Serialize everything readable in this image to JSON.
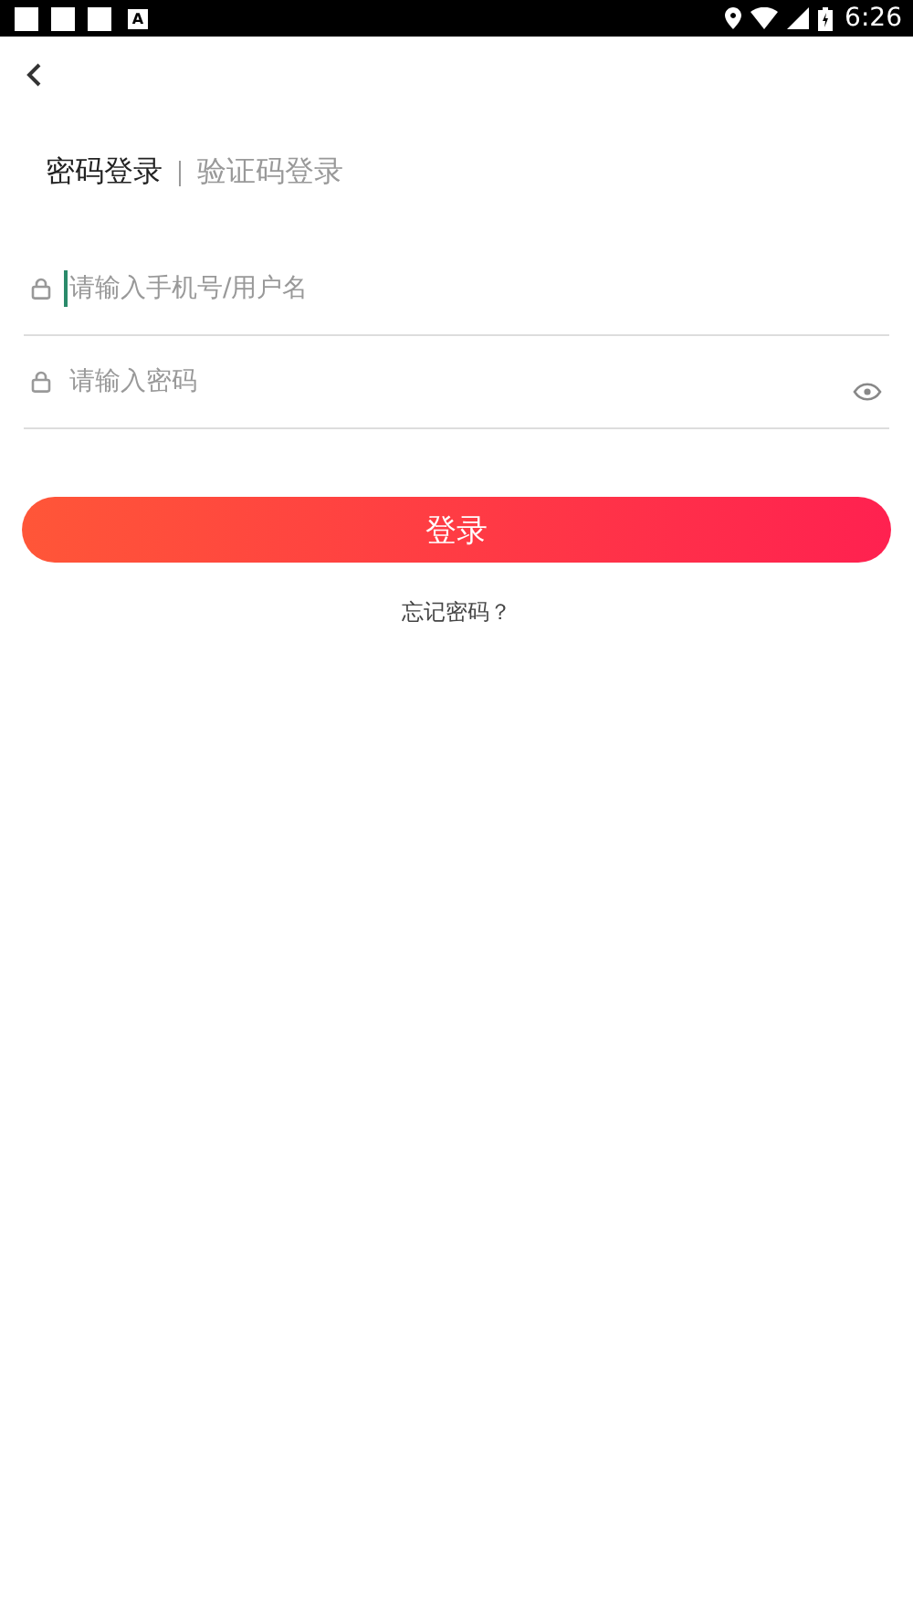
{
  "status_bar": {
    "notification_badge": "A",
    "time": "6:26"
  },
  "tabs": [
    {
      "label": "密码登录",
      "selected": true
    },
    {
      "label": "验证码登录",
      "selected": false
    }
  ],
  "fields": [
    {
      "kind": "text",
      "placeholder": "请输入手机号/用户名",
      "focused": true
    },
    {
      "kind": "password",
      "placeholder": "请输入密码",
      "focused": false
    }
  ],
  "login_button": "登录",
  "forgot_link": "忘记密码？"
}
